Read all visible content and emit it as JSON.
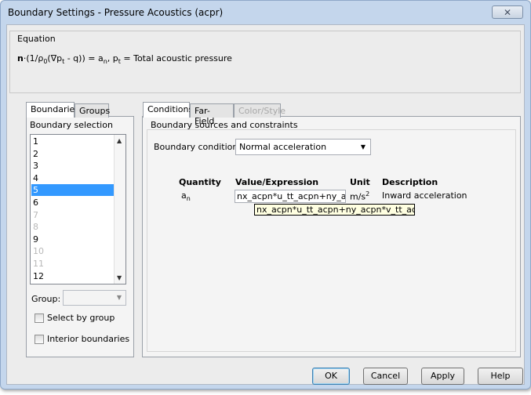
{
  "window": {
    "title": "Boundary Settings - Pressure Acoustics (acpr)",
    "close_glyph": "✕"
  },
  "equation": {
    "legend": "Equation",
    "parts": {
      "n": "n",
      "a": "·(1/ρ",
      "b": "0",
      "c": "(∇p",
      "d": "t",
      "e": " - q)) = a",
      "f": "n",
      "g": ", p",
      "h": "t",
      "i": " = Total acoustic pressure"
    }
  },
  "left_tabs": {
    "boundaries": "Boundaries",
    "groups": "Groups"
  },
  "boundary_selection": {
    "label": "Boundary selection",
    "items": [
      {
        "label": "1",
        "state": "normal"
      },
      {
        "label": "2",
        "state": "normal"
      },
      {
        "label": "3",
        "state": "normal"
      },
      {
        "label": "4",
        "state": "normal"
      },
      {
        "label": "5",
        "state": "selected"
      },
      {
        "label": "6",
        "state": "normal"
      },
      {
        "label": "7",
        "state": "disabled"
      },
      {
        "label": "8",
        "state": "disabled"
      },
      {
        "label": "9",
        "state": "normal"
      },
      {
        "label": "10",
        "state": "disabled"
      },
      {
        "label": "11",
        "state": "disabled"
      },
      {
        "label": "12",
        "state": "normal"
      }
    ],
    "group_label": "Group:",
    "group_value": "",
    "select_by_group": {
      "label": "Select by group",
      "checked": false
    },
    "interior_boundaries": {
      "label": "Interior boundaries",
      "checked": false
    }
  },
  "right_tabs": {
    "conditions": "Conditions",
    "far_field": "Far-Field",
    "color_style": "Color/Style"
  },
  "conditions": {
    "section_label": "Boundary sources and constraints",
    "bc_label": "Boundary condition:",
    "bc_value": "Normal acceleration",
    "headers": {
      "quantity": "Quantity",
      "value": "Value/Expression",
      "unit": "Unit",
      "description": "Description"
    },
    "row": {
      "quantity": "a",
      "quantity_sub": "n",
      "value": "nx_acpn*u_tt_acpn+ny_acpn*v_tt_acpn",
      "unit": "m/s",
      "unit_sup": "2",
      "description": "Inward acceleration"
    },
    "tooltip": "nx_acpn*u_tt_acpn+ny_acpn*v_tt_acpn"
  },
  "buttons": {
    "ok": "OK",
    "cancel": "Cancel",
    "apply": "Apply",
    "help": "Help"
  },
  "colors": {
    "selection": "#3399ff",
    "frame": "#c4d6ec",
    "tooltip_bg": "#ffffe1"
  }
}
